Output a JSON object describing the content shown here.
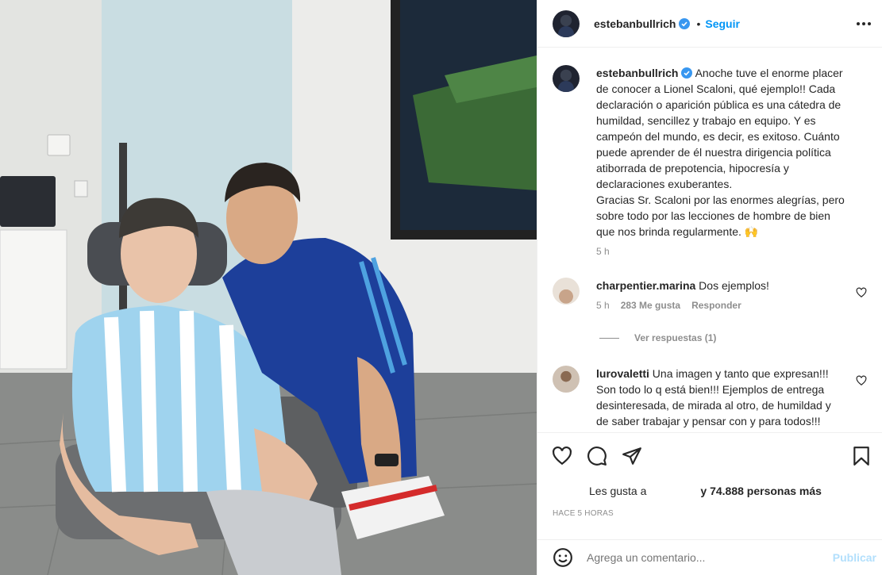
{
  "post": {
    "username": "estebanbullrich",
    "follow_label": "Seguir",
    "dot": "•",
    "caption_lines": [
      "Anoche tuve el enorme placer",
      "de conocer a Lionel Scaloni, qué ejemplo!! Cada",
      "declaración o aparición pública es una cátedra de",
      "humildad, sencillez y trabajo en equipo. Y es",
      "campeón del mundo, es decir, es exitoso. Cuánto",
      "puede aprender de él nuestra dirigencia política",
      "atiborrada de prepotencia, hipocresía y",
      "declaraciones exuberantes.",
      "Gracias Sr. Scaloni por las enormes alegrías, pero",
      "sobre todo por las lecciones de hombre de bien",
      "que nos brinda regularmente. 🙌"
    ],
    "caption_time": "5 h"
  },
  "comments": [
    {
      "username": "charpentier.marina",
      "text": "Dos ejemplos!",
      "time": "5 h",
      "likes": "283 Me gusta",
      "reply_label": "Responder",
      "view_replies": "Ver respuestas (1)"
    },
    {
      "username": "lurovaletti",
      "text_lines": [
        "Una imagen y tanto que expresan!!!",
        "Son todo lo q está bien!!! Ejemplos de entrega",
        "desinteresada, de mirada al otro, de humildad y",
        "de saber trabajar y pensar con y para todos!!!"
      ]
    }
  ],
  "actions": {
    "likes_prefix": "Les gusta a",
    "likes_suffix": "y 74.888 personas más",
    "timestamp": "HACE 5 HORAS"
  },
  "add_comment": {
    "placeholder": "Agrega un comentario...",
    "publish_label": "Publicar"
  },
  "icons": [
    "more-options-icon",
    "verified-badge-icon",
    "heart-icon",
    "comment-icon",
    "share-icon",
    "bookmark-icon",
    "emoji-icon"
  ],
  "colors": {
    "link_blue": "#0095f6",
    "publish_disabled": "#b2dffc",
    "muted": "#8e8e8e",
    "text": "#262626"
  }
}
